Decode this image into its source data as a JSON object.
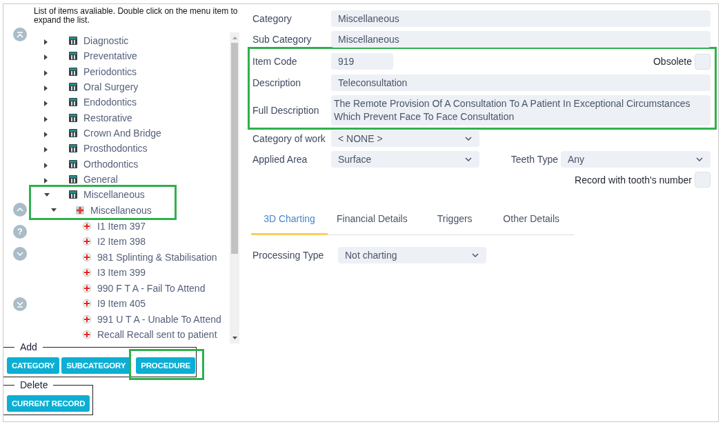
{
  "tree_panel": {
    "hint": "List of items avaliable. Double click on the menu item to expand the list.",
    "nav_buttons": [
      {
        "kind": "top"
      },
      {
        "kind": "up"
      },
      {
        "kind": "help",
        "label": "?"
      },
      {
        "kind": "down"
      },
      {
        "kind": "bottom"
      }
    ]
  },
  "tree": {
    "items": [
      {
        "label": "Diagnostic",
        "kind": "category",
        "expanded": false,
        "highlighted": false
      },
      {
        "label": "Preventative",
        "kind": "category",
        "expanded": false,
        "highlighted": false
      },
      {
        "label": "Periodontics",
        "kind": "category",
        "expanded": false,
        "highlighted": false
      },
      {
        "label": "Oral Surgery",
        "kind": "category",
        "expanded": false,
        "highlighted": false
      },
      {
        "label": "Endodontics",
        "kind": "category",
        "expanded": false,
        "highlighted": false
      },
      {
        "label": "Restorative",
        "kind": "category",
        "expanded": false,
        "highlighted": false
      },
      {
        "label": "Crown And Bridge",
        "kind": "category",
        "expanded": false,
        "highlighted": false
      },
      {
        "label": "Prosthodontics",
        "kind": "category",
        "expanded": false,
        "highlighted": false
      },
      {
        "label": "Orthodontics",
        "kind": "category",
        "expanded": false,
        "highlighted": false
      },
      {
        "label": "General",
        "kind": "category",
        "expanded": false,
        "highlighted": false
      },
      {
        "label": "Miscellaneous",
        "kind": "category",
        "expanded": true,
        "highlighted": true,
        "children": [
          {
            "label": "Miscellaneous",
            "kind": "subcategory",
            "expanded": true,
            "highlighted": true,
            "children": [
              {
                "label": "I1 Item 397",
                "kind": "procedure",
                "highlighted": false
              },
              {
                "label": "I2 Item 398",
                "kind": "procedure",
                "highlighted": false
              },
              {
                "label": "981 Splinting & Stabilisation",
                "kind": "procedure",
                "highlighted": false
              },
              {
                "label": "I3 Item 399",
                "kind": "procedure",
                "highlighted": false
              },
              {
                "label": "990 F T A - Fail To Attend",
                "kind": "procedure",
                "highlighted": false
              },
              {
                "label": "I9 Item 405",
                "kind": "procedure",
                "highlighted": false
              },
              {
                "label": "991 U T A - Unable To Attend",
                "kind": "procedure",
                "highlighted": false
              },
              {
                "label": "Recall Recall sent to patient",
                "kind": "procedure",
                "highlighted": false
              }
            ]
          }
        ]
      }
    ]
  },
  "add_group": {
    "legend": "Add",
    "buttons": [
      {
        "label": "CATEGORY",
        "highlighted": false
      },
      {
        "label": "SUBCATEGORY",
        "highlighted": false
      },
      {
        "label": "PROCEDURE",
        "highlighted": true
      }
    ]
  },
  "delete_group": {
    "legend": "Delete",
    "buttons": [
      {
        "label": "CURRENT RECORD",
        "highlighted": false
      }
    ]
  },
  "details": {
    "category": {
      "label": "Category",
      "value": "Miscellaneous"
    },
    "sub_category": {
      "label": "Sub Category",
      "value": "Miscellaneous"
    },
    "identity": {
      "highlighted": true,
      "item_code": {
        "label": "Item Code",
        "value": "919"
      },
      "obsolete": {
        "label": "Obsolete",
        "checked": false
      },
      "description": {
        "label": "Description",
        "value": "Teleconsultation"
      },
      "full_description": {
        "label": "Full Description",
        "value": "The Remote Provision Of A Consultation To A Patient In Exceptional Circumstances Which Prevent Face To Face Consultation"
      }
    },
    "category_of_work": {
      "label": "Category of work",
      "value": "< NONE >"
    },
    "applied_area": {
      "label": "Applied Area",
      "value": "Surface"
    },
    "teeth_type": {
      "label": "Teeth Type",
      "value": "Any"
    },
    "record_with_tooth_number": {
      "label": "Record with tooth's number",
      "checked": false
    }
  },
  "tabs": [
    {
      "label": "3D Charting",
      "selected": true
    },
    {
      "label": "Financial Details",
      "selected": false
    },
    {
      "label": "Triggers",
      "selected": false
    },
    {
      "label": "Other Details",
      "selected": false
    }
  ],
  "charting": {
    "processing_type": {
      "label": "Processing Type",
      "value": "Not charting"
    }
  }
}
